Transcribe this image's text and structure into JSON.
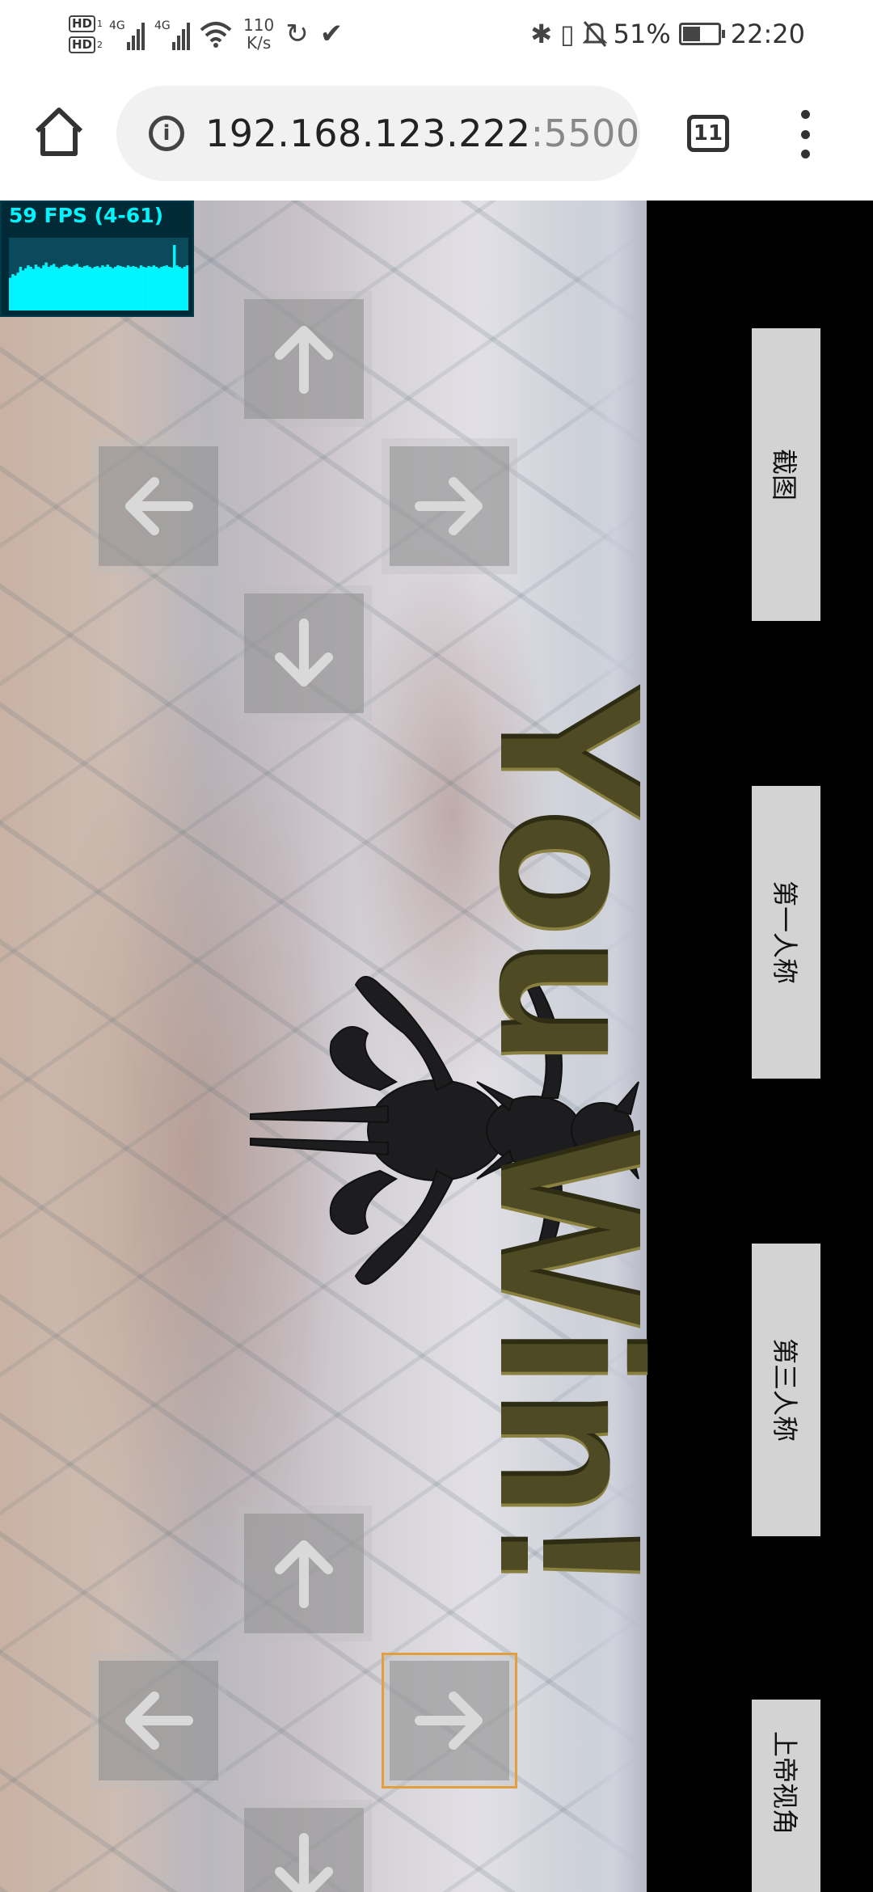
{
  "status_bar": {
    "hd1": "HD",
    "hd1_sub": "1",
    "hd2": "HD",
    "hd2_sub": "2",
    "network1": "4G",
    "network2": "4G",
    "speed_value": "110",
    "speed_unit": "K/s",
    "battery_percent": "51%",
    "battery_level": 0.51,
    "time": "22:20",
    "icons": [
      "hd-icon",
      "signal-icon",
      "wifi-icon",
      "app-icon",
      "check-icon",
      "bluetooth-icon",
      "vibrate-icon",
      "mute-icon",
      "battery-icon"
    ]
  },
  "browser": {
    "url_host": "192.168.123.222",
    "url_port": ":5500",
    "tab_count": "11",
    "icons": [
      "home-icon",
      "info-icon",
      "tabs-icon",
      "more-icon"
    ]
  },
  "game": {
    "fps_label": "59 FPS (4-61)",
    "fps_history": [
      0.45,
      0.5,
      0.48,
      0.52,
      0.6,
      0.55,
      0.58,
      0.62,
      0.6,
      0.57,
      0.63,
      0.6,
      0.58,
      0.62,
      0.66,
      0.6,
      0.62,
      0.64,
      0.6,
      0.58,
      0.6,
      0.62,
      0.63,
      0.61,
      0.6,
      0.62,
      0.64,
      0.6,
      0.59,
      0.61,
      0.62,
      0.6,
      0.58,
      0.6,
      0.61,
      0.59,
      0.62,
      0.6,
      0.63,
      0.6,
      0.58,
      0.6,
      0.62,
      0.61,
      0.6,
      0.59,
      0.62,
      0.6,
      0.61,
      0.6,
      0.58,
      0.62,
      0.6,
      0.59,
      0.61,
      0.6,
      0.62,
      0.6,
      0.58,
      0.6,
      0.61,
      0.62,
      0.6,
      0.59,
      0.9,
      0.62,
      0.6,
      0.58,
      0.6,
      0.62
    ],
    "win_text": "You Win!",
    "side_buttons": [
      "截图",
      "第一人称",
      "第三人称",
      "上帝视角"
    ],
    "dpad_top": {
      "up": "up-arrow-icon",
      "left": "left-arrow-icon",
      "right": "right-arrow-icon",
      "down": "down-arrow-icon"
    },
    "dpad_bottom": {
      "up": "up-arrow-icon",
      "left": "left-arrow-icon",
      "right": "right-arrow-icon",
      "down": "down-arrow-icon"
    },
    "colors": {
      "fps_text": "#00f5ff",
      "fps_bg": "#002a36",
      "win_text": "#4d4a24",
      "focus_border": "#e0a040"
    }
  }
}
